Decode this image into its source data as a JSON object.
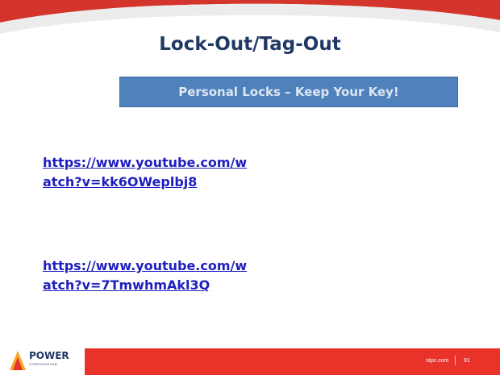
{
  "slide": {
    "title": "Lock-Out/Tag-Out",
    "subtitle": "Personal Locks – Keep Your Key!",
    "links": [
      "https://www.youtube.com/watch?v=kk6OWeplbj8",
      "https://www.youtube.com/watch?v=7TmwhmAkl3Q"
    ]
  },
  "footer": {
    "logo_text": "POWER",
    "logo_sub": "CORPORATION",
    "logo_tag": "",
    "site": "ntpc.com",
    "page": "91"
  },
  "colors": {
    "title": "#1f3864",
    "subtitle_box": "#4f81bd",
    "link": "#1f1fbf",
    "footer_bar": "#e8322a"
  }
}
